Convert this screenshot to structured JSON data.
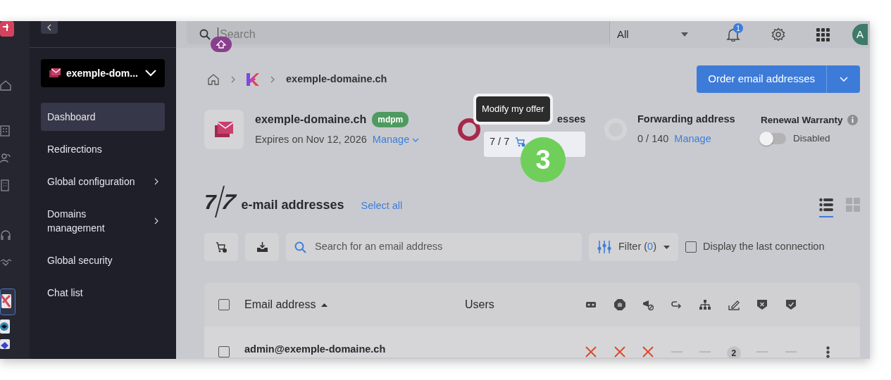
{
  "sidebar": {
    "domain_selector": "exemple-dom...",
    "items": [
      {
        "label": "Dashboard",
        "selected": true,
        "submenu": false
      },
      {
        "label": "Redirections",
        "selected": false,
        "submenu": false
      },
      {
        "label": "Global configuration",
        "selected": false,
        "submenu": true
      },
      {
        "label": "Domains management",
        "selected": false,
        "submenu": true
      },
      {
        "label": "Global security",
        "selected": false,
        "submenu": false
      },
      {
        "label": "Chat list",
        "selected": false,
        "submenu": false
      }
    ]
  },
  "topbar": {
    "search_placeholder": "Search",
    "scope": "All",
    "notifications": "1",
    "avatar": "A"
  },
  "breadcrumb": [
    "exemple-domaine.ch"
  ],
  "order_button": "Order email addresses",
  "product": {
    "name": "exemple-domaine.ch",
    "badge": "mdpm",
    "expiry": "Expires on Nov 12, 2026",
    "manage": "Manage"
  },
  "stats": [
    {
      "kind": "usage",
      "label": "esses",
      "value": "7 / 7",
      "color": "#a8294a"
    },
    {
      "kind": "forwarding",
      "label": "Forwarding address",
      "value": "0 / 140",
      "link": "Manage",
      "color": "#d4d4d6"
    }
  ],
  "renewal": {
    "label": "Renewal Warranty",
    "on": false,
    "status": "Disabled"
  },
  "tooltip": "Modify my offer",
  "step_badge": "3",
  "list": {
    "count": "7",
    "total": "7",
    "title": "e-mail addresses",
    "select_all": "Select all"
  },
  "view_toggle": [
    {
      "kind": "list",
      "selected": true
    },
    {
      "kind": "grid",
      "selected": false
    }
  ],
  "toolbar": {
    "search_placeholder": "Search for an email address",
    "filter": {
      "label": "Filter (",
      "count": "0",
      "close": ")"
    },
    "last_connection": {
      "label": "Display the last connection",
      "checked": false
    }
  },
  "table": {
    "columns": [
      {
        "label": "Email address",
        "sorted": true
      },
      {
        "label": "Users",
        "sorted": false
      }
    ],
    "all_selected": false,
    "rows": [
      {
        "email": "admin@exemple-domaine.ch",
        "selected": false,
        "cells": [
          {
            "kind": "cross"
          },
          {
            "kind": "cross"
          },
          {
            "kind": "cross"
          },
          {
            "kind": "dash"
          },
          {
            "kind": "dash"
          },
          {
            "kind": "count",
            "text": "2"
          },
          {
            "kind": "dash"
          },
          {
            "kind": "dash"
          }
        ]
      }
    ]
  }
}
